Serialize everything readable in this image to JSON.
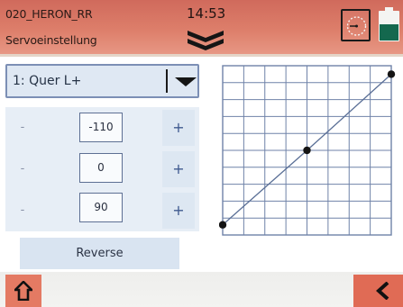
{
  "header": {
    "model_name": "020_HERON_RR",
    "screen_title": "Servoeinstellung",
    "clock": "14:53",
    "menu_icon": "double-chevron-down-icon",
    "timer_icon": "timer-icon",
    "battery_level": 0.55,
    "colors": {
      "bar": "#dd7e6a",
      "battery": "#14684e"
    }
  },
  "channel_select": {
    "value": "1: Quer L+",
    "icon": "triangle-down-icon"
  },
  "rows": [
    {
      "minus": "-",
      "value": "-110",
      "plus": "+"
    },
    {
      "minus": "-",
      "value": "0",
      "plus": "+"
    },
    {
      "minus": "-",
      "value": "90",
      "plus": "+"
    }
  ],
  "reverse_label": "Reverse",
  "chart_data": {
    "type": "line",
    "grid": true,
    "xlim": [
      -1,
      1
    ],
    "ylim": [
      -1,
      1
    ],
    "points": [
      {
        "x": -1,
        "y": -0.88
      },
      {
        "x": 0,
        "y": 0
      },
      {
        "x": 1,
        "y": 0.9
      }
    ],
    "colors": {
      "grid": "#6f82a8",
      "line": "#5a6f96",
      "point": "#141414"
    }
  },
  "footer": {
    "home_icon": "home-icon",
    "back_icon": "chevron-left-icon",
    "colors": {
      "button": "#e06b55"
    }
  }
}
